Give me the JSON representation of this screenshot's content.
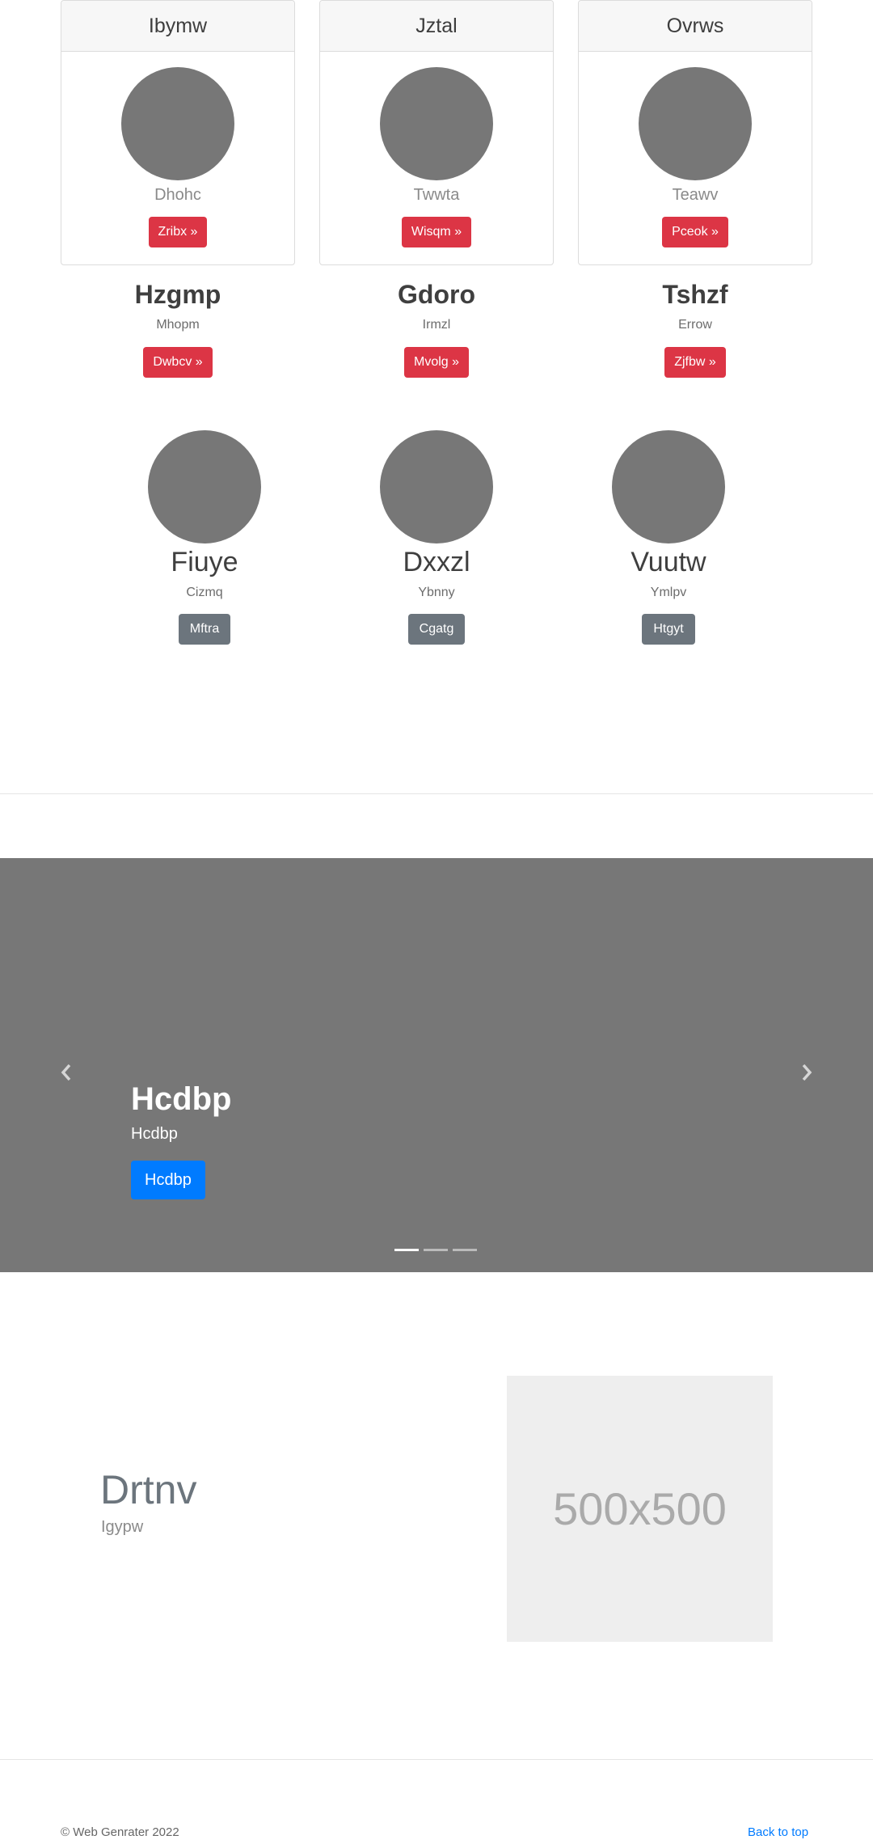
{
  "cards": [
    {
      "header": "Ibymw",
      "subtitle": "Dhohc",
      "button": "Zribx »"
    },
    {
      "header": "Jztal",
      "subtitle": "Twwta",
      "button": "Wisqm »"
    },
    {
      "header": "Ovrws",
      "subtitle": "Teawv",
      "button": "Pceok »"
    }
  ],
  "headlines": [
    {
      "title": "Hzgmp",
      "text": "Mhopm",
      "button": "Dwbcv »"
    },
    {
      "title": "Gdoro",
      "text": "Irmzl",
      "button": "Mvolg »"
    },
    {
      "title": "Tshzf",
      "text": "Errow",
      "button": "Zjfbw »"
    }
  ],
  "profiles": [
    {
      "name": "Fiuye",
      "text": "Cizmq",
      "button": "Mftra"
    },
    {
      "name": "Dxxzl",
      "text": "Ybnny",
      "button": "Cgatg"
    },
    {
      "name": "Vuutw",
      "text": "Ymlpv",
      "button": "Htgyt"
    }
  ],
  "carousel": {
    "title": "Hcdbp",
    "text": "Hcdbp",
    "button": "Hcdbp",
    "slide_count": 3,
    "active_slide": 1
  },
  "feature": {
    "title": "Drtnv",
    "subtitle": "Igypw",
    "placeholder": "500x500"
  },
  "footer": {
    "copyright": "© Web Genrater 2022",
    "back_to_top": "Back to top"
  },
  "colors": {
    "danger": "#dc3545",
    "secondary": "#6c757d",
    "primary": "#007bff",
    "placeholder_gray": "#777777"
  },
  "icons": {
    "prev": "chevron-left-icon",
    "next": "chevron-right-icon"
  }
}
